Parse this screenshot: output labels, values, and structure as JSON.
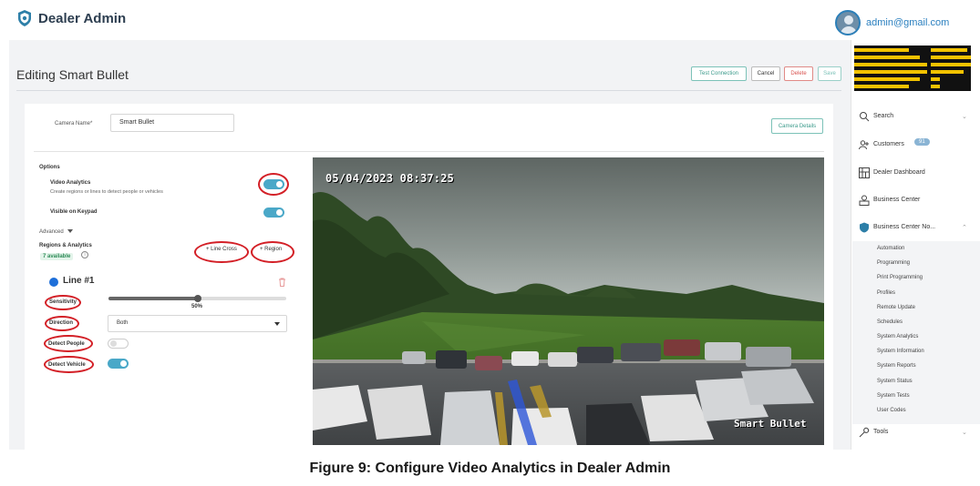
{
  "app": {
    "title": "Dealer Admin",
    "user_email": "admin@gmail.com"
  },
  "header": {
    "page_title": "Editing Smart Bullet",
    "buttons": {
      "test": "Test Connection",
      "cancel": "Cancel",
      "delete": "Delete",
      "save": "Save"
    }
  },
  "camera_form": {
    "name_label": "Camera Name*",
    "name_value": "Smart Bullet",
    "details_button": "Camera Details"
  },
  "options": {
    "heading": "Options",
    "video_analytics": {
      "label": "Video Analytics",
      "desc": "Create regions or lines to detect people or vehicles",
      "on": true
    },
    "visible_keypad": {
      "label": "Visible on Keypad",
      "on": true
    },
    "advanced": "Advanced",
    "regions": {
      "label": "Regions & Analytics",
      "available": "7 available"
    },
    "add_line_cross": "+ Line Cross",
    "add_region": "+ Region"
  },
  "line": {
    "title": "Line #1",
    "sensitivity_label": "Sensitivity",
    "sensitivity_value": 0.5,
    "sensitivity_text": "50%",
    "direction_label": "Direction",
    "direction_value": "Both",
    "detect_people_label": "Detect People",
    "detect_people_on": false,
    "detect_vehicle_label": "Detect Vehicle",
    "detect_vehicle_on": true
  },
  "camera_view": {
    "timestamp": "05/04/2023 08:37:25",
    "overlay_name": "Smart Bullet"
  },
  "sidebar": {
    "items": [
      {
        "label": "Search",
        "icon": "search-icon"
      },
      {
        "label": "Customers",
        "icon": "customers-icon",
        "count": "91"
      },
      {
        "label": "Dealer Dashboard",
        "icon": "dashboard-icon"
      },
      {
        "label": "Business Center",
        "icon": "business-center-icon"
      },
      {
        "label": "Business Center No...",
        "icon": "shield-icon"
      },
      {
        "label": "Tools",
        "icon": "wrench-icon"
      }
    ],
    "sub_items": [
      "Automation",
      "Programming",
      "Print Programming",
      "Profiles",
      "Remote Update",
      "Schedules",
      "System Analytics",
      "System Information",
      "System Reports",
      "System Status",
      "System Tests",
      "User Codes"
    ]
  },
  "caption": "Figure 9:  Configure Video Analytics in Dealer Admin",
  "colors": {
    "accent": "#4aa8c8",
    "highlight": "#d31f26",
    "delete": "#d9534f",
    "brand": "#2d3e50"
  }
}
